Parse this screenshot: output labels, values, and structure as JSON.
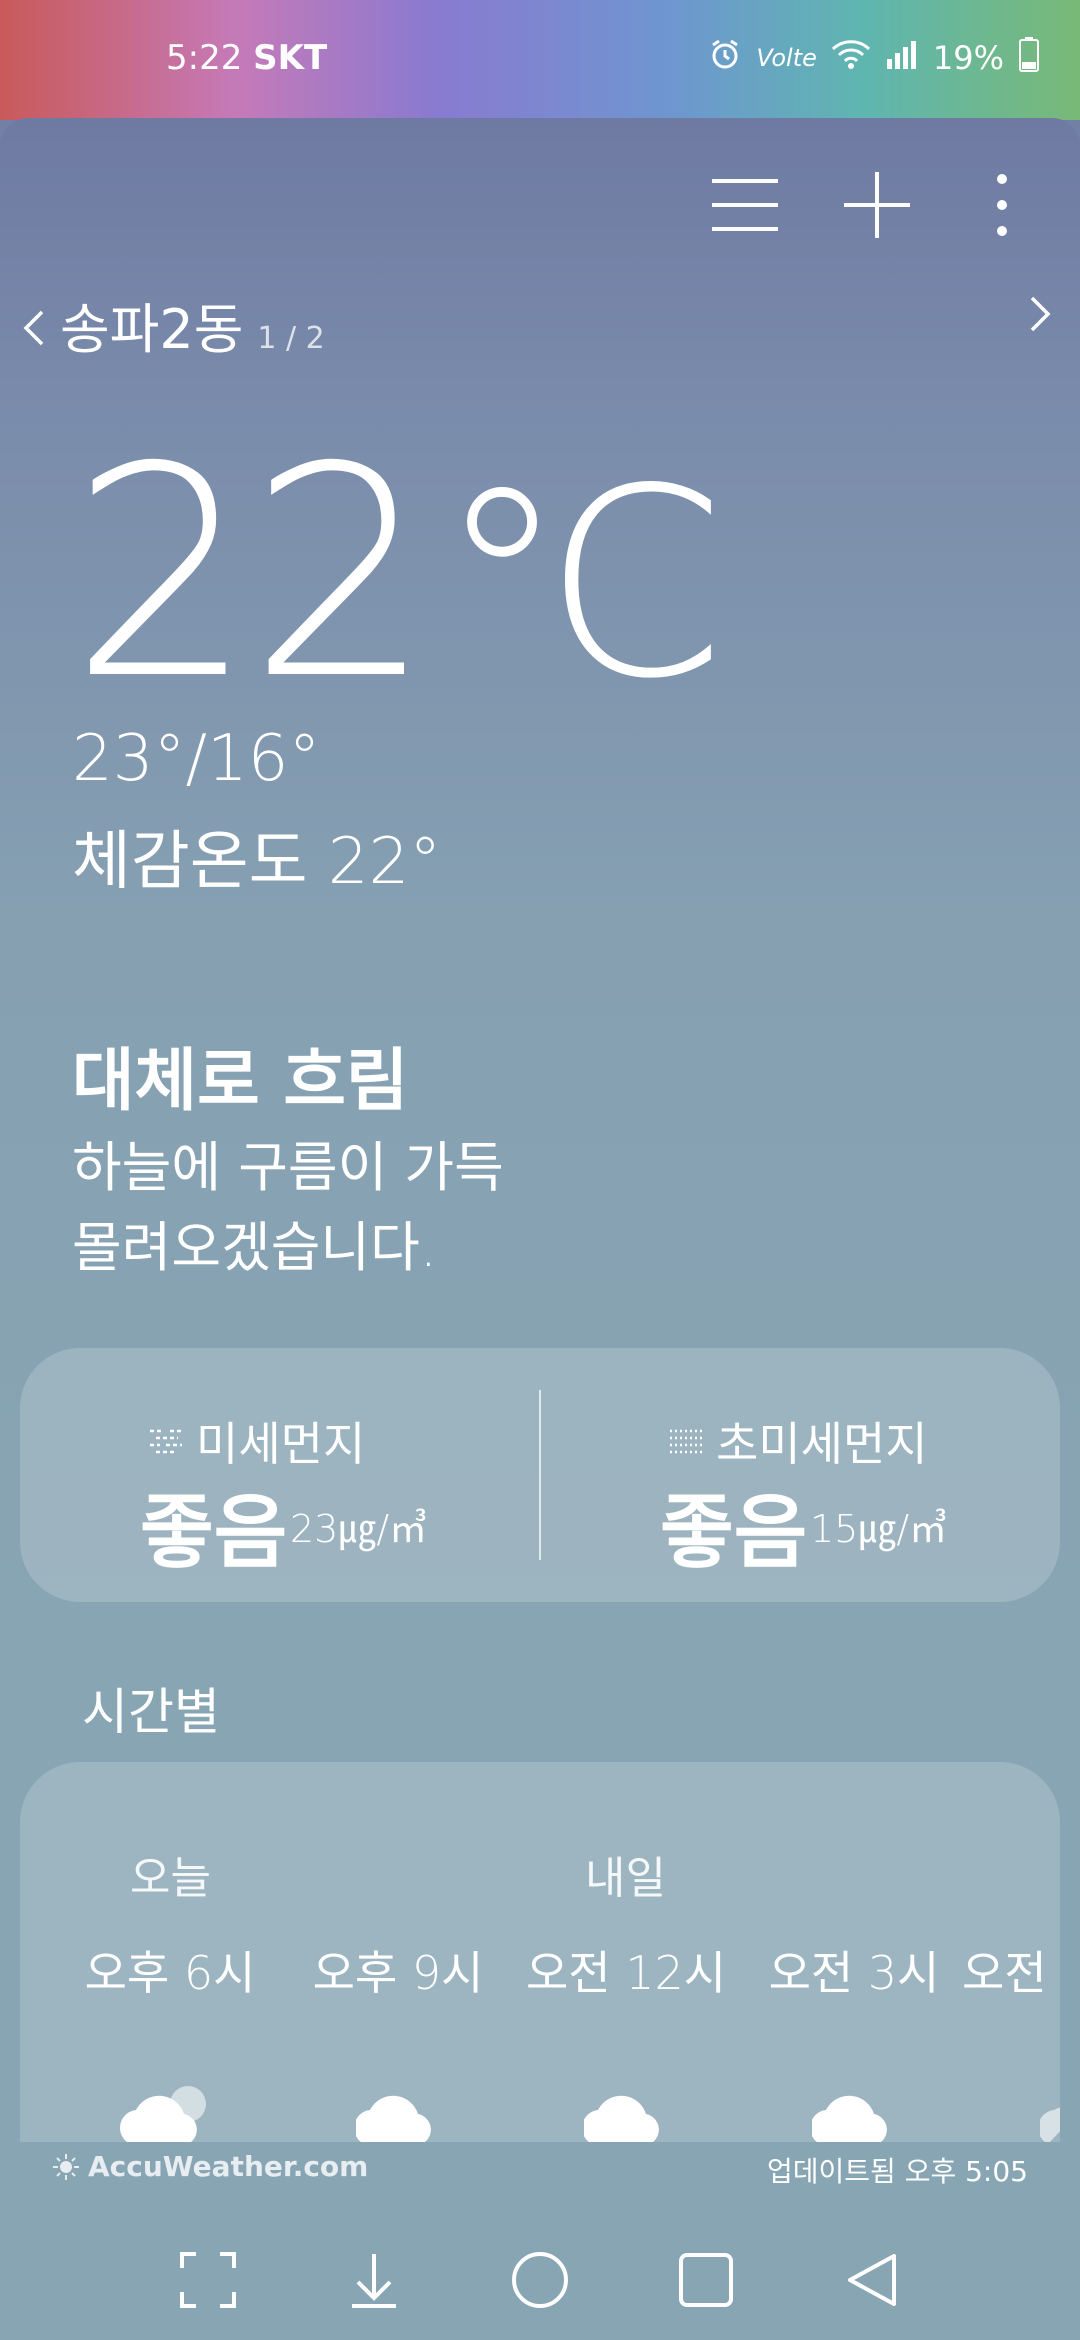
{
  "status": {
    "time": "5:22",
    "carrier": "SKT",
    "volte": "Volte",
    "battery": "19%"
  },
  "location": {
    "name": "송파2동",
    "page": "1 / 2"
  },
  "weather": {
    "temp": "22",
    "unit": "℃",
    "hilo": "23°/16°",
    "feels": "체감온도 22°",
    "condition": "대체로 흐림",
    "description_line1": "하늘에 구름이 가득",
    "description_line2": "몰려오겠습니다."
  },
  "dust": {
    "fine": {
      "label": "미세먼지",
      "status": "좋음",
      "value": "23㎍/㎥"
    },
    "ultrafine": {
      "label": "초미세먼지",
      "status": "좋음",
      "value": "15㎍/㎥"
    }
  },
  "hourly": {
    "title": "시간별",
    "today_label": "오늘",
    "tomorrow_label": "내일",
    "hours": [
      "오후 6시",
      "오후 9시",
      "오전 12시",
      "오전 3시",
      "오전"
    ]
  },
  "footer": {
    "brand": "AccuWeather.com",
    "updated": "업데이트됨 오후 5:05"
  },
  "icons": {
    "menu": "menu-icon",
    "add": "plus-icon",
    "more": "more-vert-icon",
    "prev": "chevron-left-icon",
    "next": "chevron-right-icon"
  }
}
